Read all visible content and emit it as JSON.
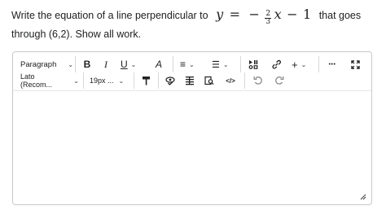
{
  "question": {
    "text_before": "Write the equation of a line perpendicular to",
    "eq_y": "y",
    "eq_equals": "=",
    "eq_minus": "−",
    "frac_num": "2",
    "frac_den": "3",
    "eq_x": "x",
    "eq_minus2": "−",
    "eq_const": "1",
    "text_after": "that goes",
    "line2": "through (6,2). Show all work."
  },
  "toolbar": {
    "row1": {
      "paragraph": "Paragraph",
      "bold": "B",
      "italic": "I",
      "underline": "U",
      "text_color": "A",
      "align": "≡",
      "list": "☰",
      "insert_symbol": "+",
      "more": "•••"
    },
    "row2": {
      "font": "Lato (Recom...",
      "size": "19px ...",
      "source": "</>"
    }
  },
  "editor": {
    "content": ""
  },
  "colors": {
    "border": "#c7c9cc",
    "text": "#202122",
    "muted": "#8a8d91"
  }
}
